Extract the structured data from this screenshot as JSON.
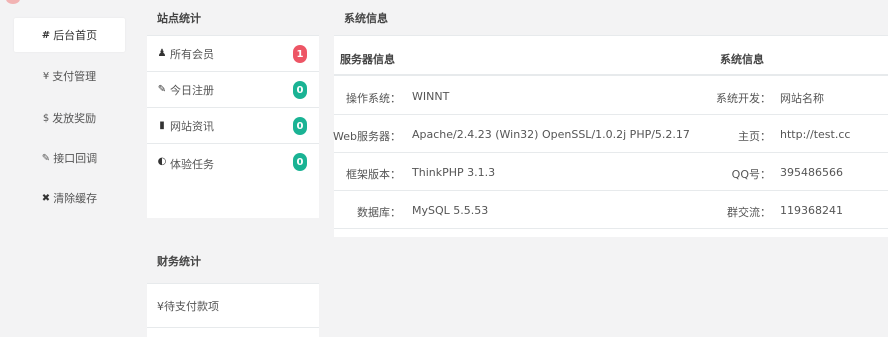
{
  "sidebar": {
    "items": [
      {
        "icon": "#",
        "label": "后台首页"
      },
      {
        "icon": "¥",
        "label": "支付管理"
      },
      {
        "icon": "$",
        "label": "发放奖励"
      },
      {
        "icon": "✎",
        "label": "接口回调"
      },
      {
        "icon": "✖",
        "label": "清除缓存"
      }
    ]
  },
  "site_stats": {
    "title": "站点统计",
    "rows": [
      {
        "icon": "user-icon",
        "glyph": "♟",
        "label": "所有会员",
        "count": "1",
        "badge_color": "#ed5565"
      },
      {
        "icon": "pencil-icon",
        "glyph": "✎",
        "label": "今日注册",
        "count": "0",
        "badge_color": "#1ab394"
      },
      {
        "icon": "book-icon",
        "glyph": "▮",
        "label": "网站资讯",
        "count": "0",
        "badge_color": "#1ab394"
      },
      {
        "icon": "shield-icon",
        "glyph": "◐",
        "label": "体验任务",
        "count": "0",
        "badge_color": "#1ab394"
      }
    ]
  },
  "finance_stats": {
    "title": "财务统计",
    "rows": [
      {
        "label": "¥待支付款项"
      }
    ]
  },
  "system_info": {
    "title": "系统信息",
    "server_header": "服务器信息",
    "system_header": "系统信息",
    "rows": [
      {
        "label": "操作系统：",
        "value": "WINNT",
        "label2": "系统开发：",
        "value2": "网站名称"
      },
      {
        "label": "Web服务器：",
        "value": "Apache/2.4.23 (Win32) OpenSSL/1.0.2j PHP/5.2.17",
        "label2": "主页：",
        "value2": "http://test.cc"
      },
      {
        "label": "框架版本：",
        "value": "ThinkPHP 3.1.3",
        "label2": "QQ号：",
        "value2": "395486566"
      },
      {
        "label": "数据库：",
        "value": "MySQL 5.5.53",
        "label2": "群交流：",
        "value2": "119368241"
      }
    ]
  }
}
